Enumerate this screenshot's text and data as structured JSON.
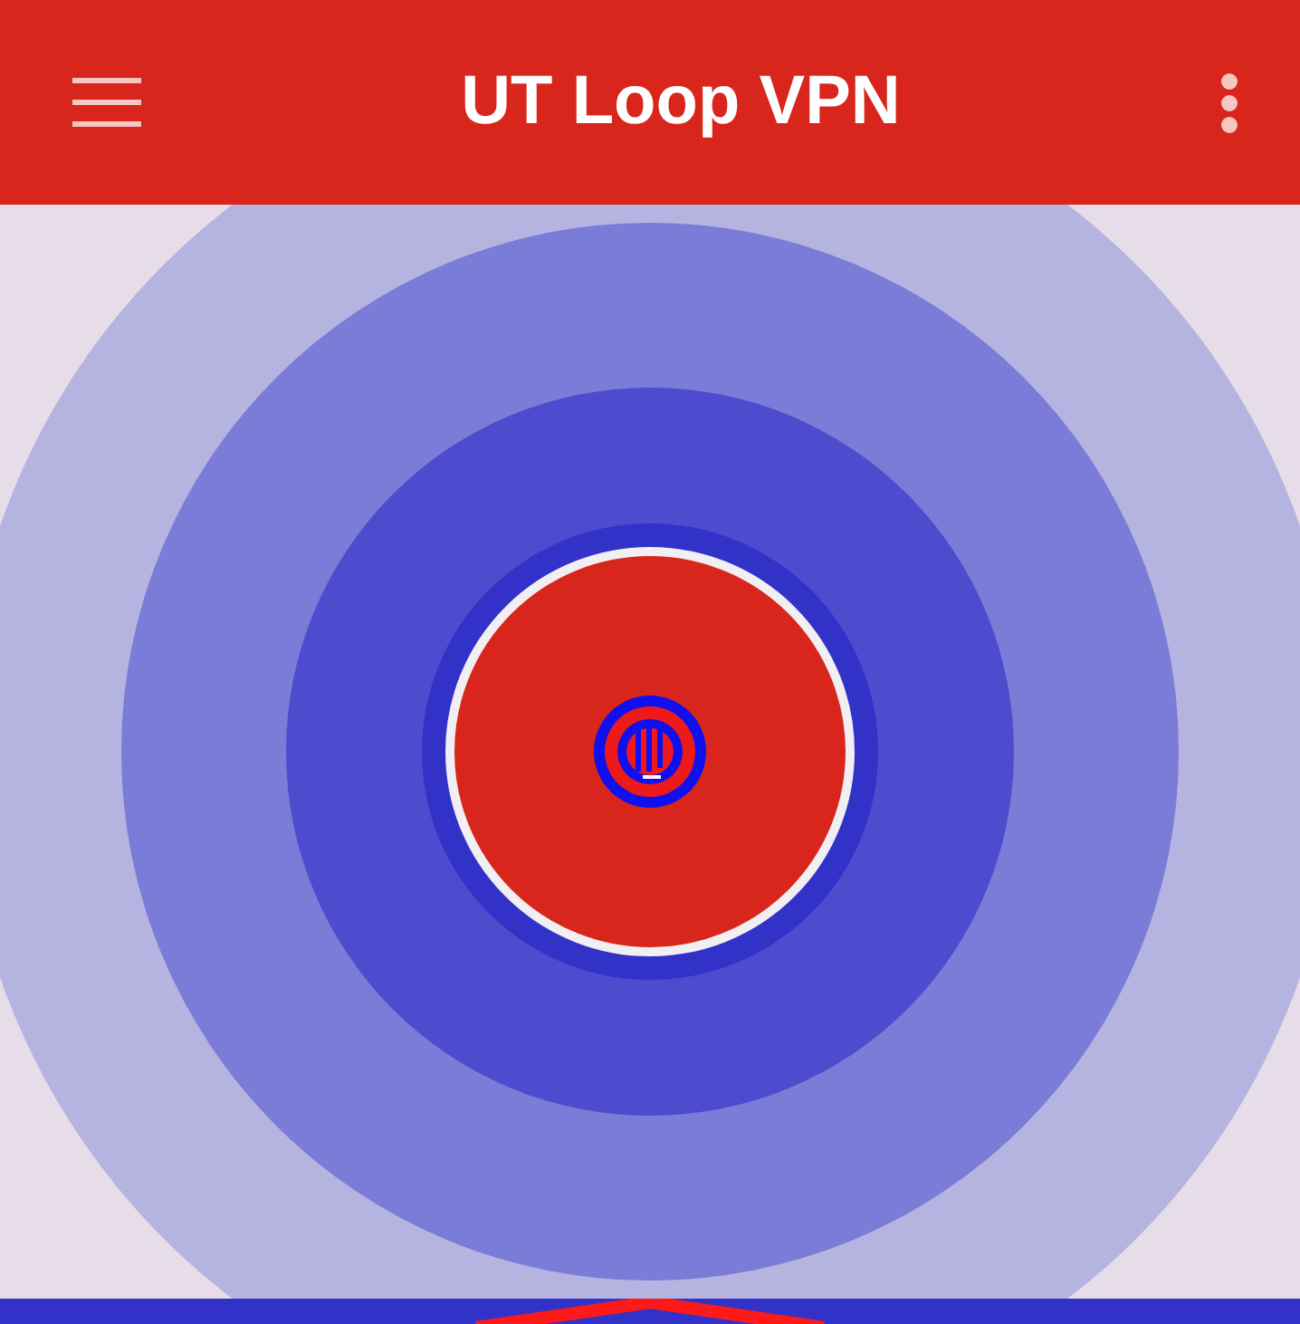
{
  "app_bar": {
    "title": "UT Loop VPN"
  }
}
